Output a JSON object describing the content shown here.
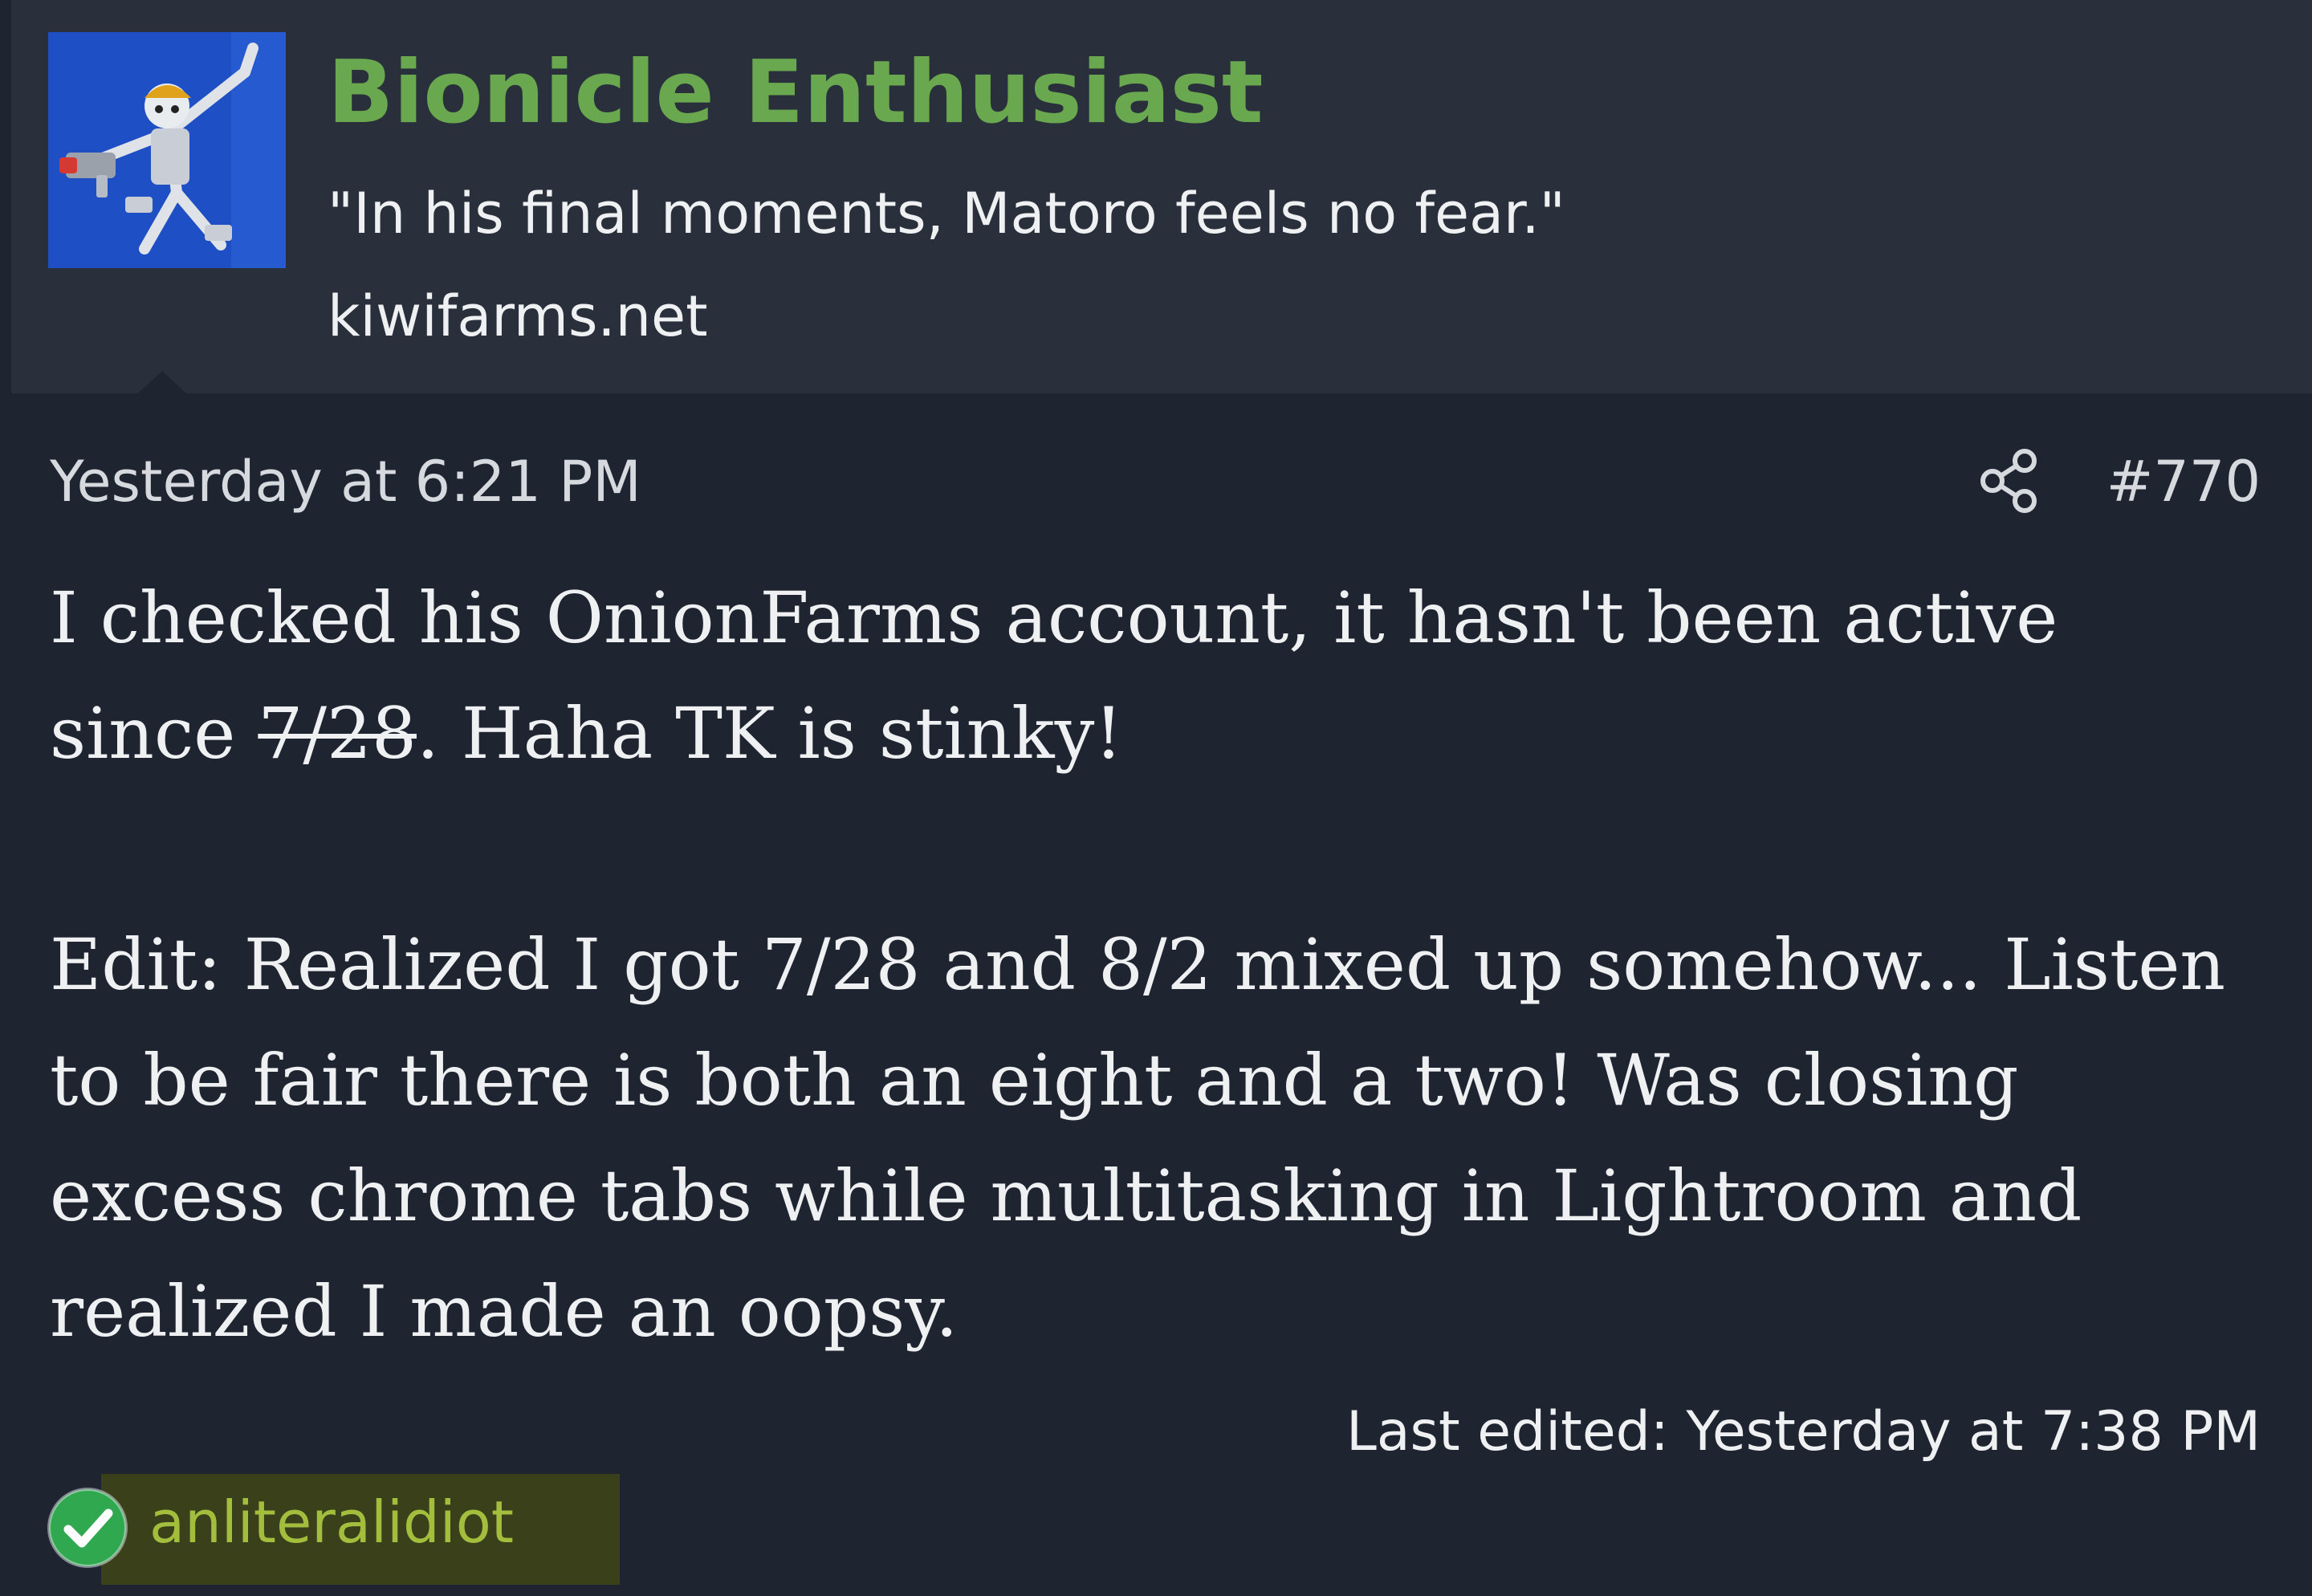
{
  "user": {
    "name": "Bionicle Enthusiast",
    "title": "\"In his final moments, Matoro feels no fear.\"",
    "site": "kiwifarms.net",
    "avatar_icon": "bionicle-figure-avatar"
  },
  "post": {
    "timestamp": "Yesterday at 6:21 PM",
    "share_icon": "share-icon",
    "number": "#770",
    "paragraph1": {
      "text_before": "I checked his OnionFarms account, it hasn't been active since ",
      "struck_text": "7/28",
      "text_after": ". Haha TK is stinky!"
    },
    "paragraph2": "Edit: Realized I got 7/28 and 8/2 mixed up somehow... Listen to be fair there is both an eight and a two! Was closing excess chrome tabs while multitasking in Lightroom and realized I made an oopsy.",
    "last_edited": "Last edited: Yesterday at 7:38 PM"
  },
  "reactions": {
    "icon": "check-circle-icon",
    "reactor": "anliteralidiot"
  },
  "colors": {
    "username": "#6aa84f",
    "reactor": "#a3bd3d",
    "header_bg": "#29303b",
    "post_bg": "#1f2530",
    "check_green": "#2fa84f"
  }
}
